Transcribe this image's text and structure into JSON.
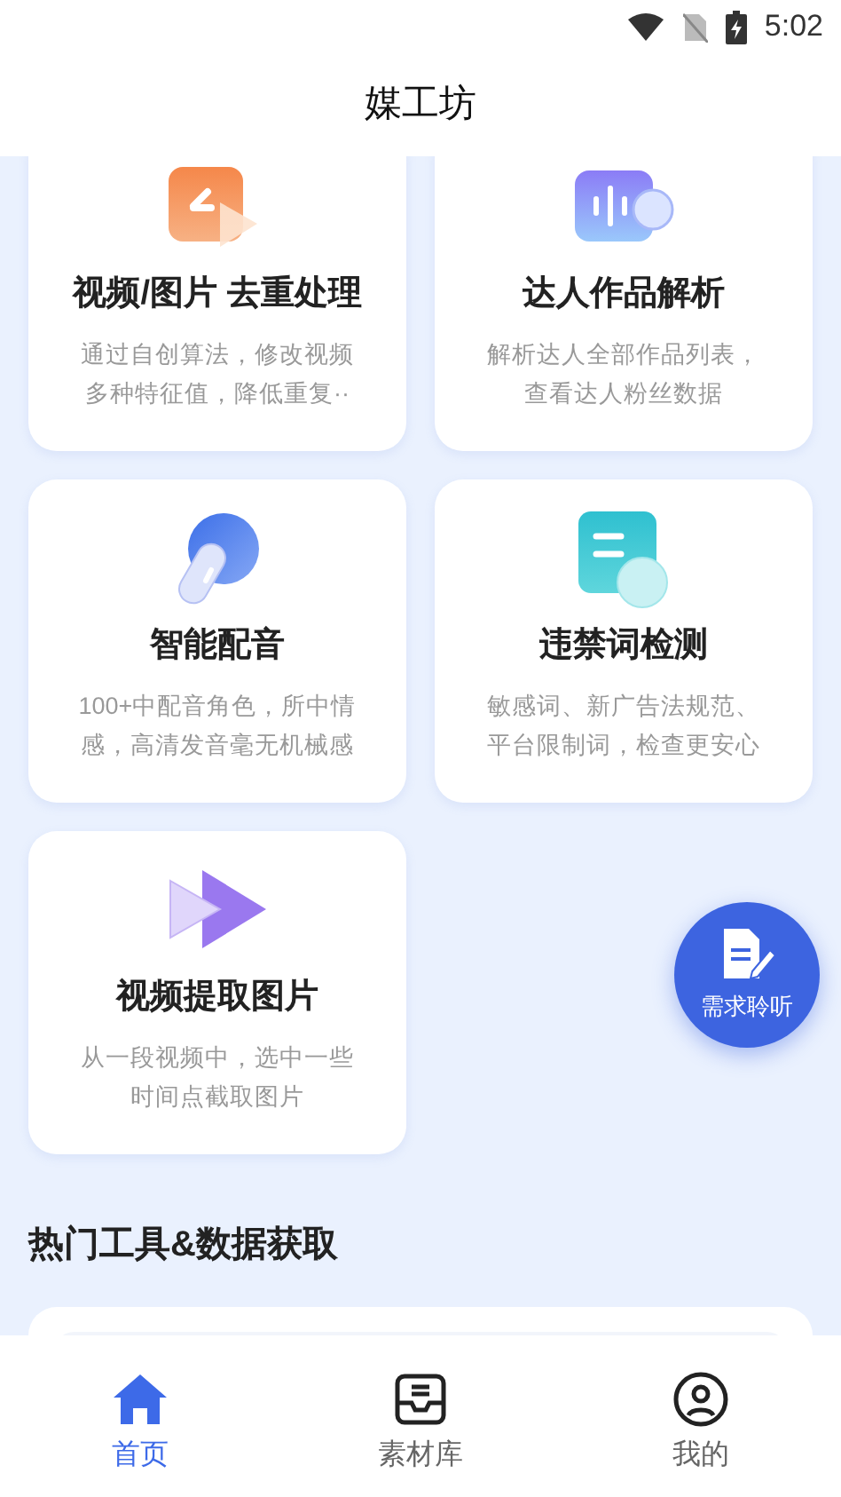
{
  "status_bar": {
    "time": "5:02"
  },
  "header": {
    "title": "媒工坊"
  },
  "tools": [
    {
      "kind": "dedupe",
      "title": "视频/图片 去重处理",
      "lines": [
        "通过自创算法，修改视频",
        "多种特征值，降低重复··"
      ]
    },
    {
      "kind": "analysis",
      "title": "达人作品解析",
      "lines": [
        "解析达人全部作品列表，",
        "查看达人粉丝数据"
      ]
    },
    {
      "kind": "voice",
      "title": "智能配音",
      "lines": [
        "100+中配音角色，所中情",
        "感，高清发音毫无机械感"
      ]
    },
    {
      "kind": "words",
      "title": "违禁词检测",
      "lines": [
        "敏感词、新广告法规范、",
        "平台限制词，检查更安心"
      ]
    },
    {
      "kind": "extract",
      "title": "视频提取图片",
      "lines": [
        "从一段视频中，选中一些",
        "时间点截取图片"
      ]
    }
  ],
  "section": {
    "title": "热门工具&数据获取"
  },
  "fab": {
    "label": "需求聆听"
  },
  "nav": [
    {
      "kind": "home",
      "label": "首页",
      "selected": true
    },
    {
      "kind": "library",
      "label": "素材库",
      "selected": false
    },
    {
      "kind": "mine",
      "label": "我的",
      "selected": false
    }
  ]
}
